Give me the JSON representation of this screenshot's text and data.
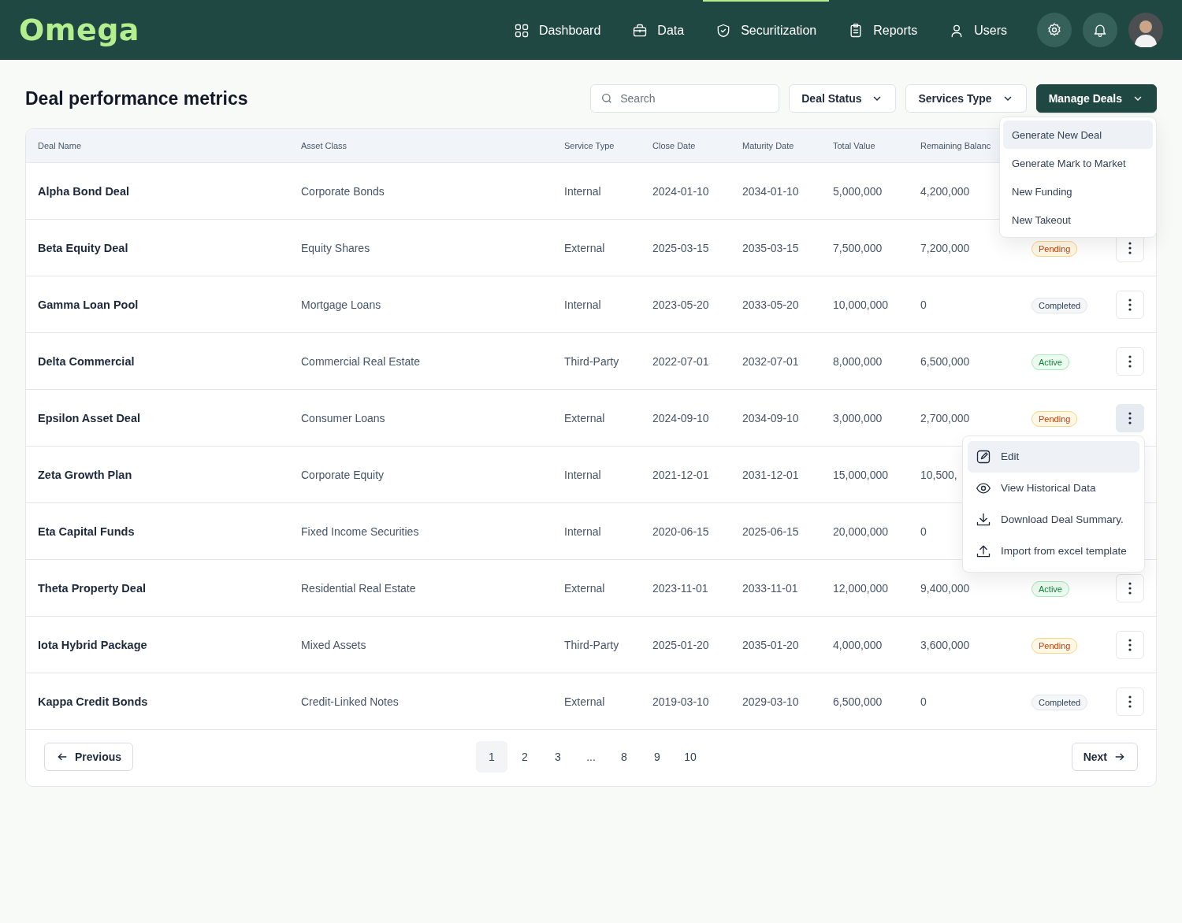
{
  "app": {
    "logo": "Omega"
  },
  "nav": [
    {
      "label": "Dashboard",
      "kind": "grid",
      "selected": false
    },
    {
      "label": "Data",
      "kind": "briefcase",
      "selected": false
    },
    {
      "label": "Securitization",
      "kind": "shield",
      "selected": true
    },
    {
      "label": "Reports",
      "kind": "clipboard",
      "selected": false
    },
    {
      "label": "Users",
      "kind": "user",
      "selected": false
    }
  ],
  "page": {
    "title": "Deal performance metrics"
  },
  "search": {
    "placeholder": "Search"
  },
  "filters": [
    {
      "label": "Deal Status",
      "kind": "outline"
    },
    {
      "label": "Services Type",
      "kind": "outline"
    },
    {
      "label": "Manage Deals",
      "kind": "primary",
      "expanded": true
    }
  ],
  "manage_menu": [
    {
      "label": "Generate New Deal",
      "selected": true
    },
    {
      "label": "Generate Mark to Market",
      "selected": false
    },
    {
      "label": "New Funding",
      "selected": false
    },
    {
      "label": "New Takeout",
      "selected": false
    }
  ],
  "table": {
    "columns": [
      "Deal Name",
      "Asset Class",
      "Service Type",
      "Close Date",
      "Maturity Date",
      "Total Value",
      "Remaining Balanc"
    ],
    "rows": [
      {
        "cells": [
          "Alpha Bond Deal",
          "Corporate Bonds",
          "Internal",
          "2024-01-10",
          "2034-01-10",
          "5,000,000",
          "4,200,000"
        ]
      },
      {
        "cells": [
          "Beta Equity Deal",
          "Equity Shares",
          "External",
          "2025-03-15",
          "2035-03-15",
          "7,500,000",
          "7,200,000"
        ],
        "status": {
          "label": "Pending",
          "kind": "pending"
        },
        "action": {
          "selected": false
        }
      },
      {
        "cells": [
          "Gamma Loan Pool",
          "Mortgage Loans",
          "Internal",
          "2023-05-20",
          "2033-05-20",
          "10,000,000",
          "0"
        ],
        "status": {
          "label": "Completed",
          "kind": "completed"
        },
        "action": {
          "selected": false
        }
      },
      {
        "cells": [
          "Delta Commercial",
          "Commercial Real Estate",
          "Third-Party",
          "2022-07-01",
          "2032-07-01",
          "8,000,000",
          "6,500,000"
        ],
        "status": {
          "label": "Active",
          "kind": "active"
        },
        "action": {
          "selected": false
        }
      },
      {
        "cells": [
          "Epsilon Asset Deal",
          "Consumer Loans",
          "External",
          "2024-09-10",
          "2034-09-10",
          "3,000,000",
          "2,700,000"
        ],
        "status": {
          "label": "Pending",
          "kind": "pending"
        },
        "action": {
          "selected": true
        },
        "menu": [
          {
            "label": "Edit",
            "kind": "edit",
            "selected": true
          },
          {
            "label": "View Historical Data",
            "kind": "view",
            "selected": false
          },
          {
            "label": "Download Deal Summary.",
            "kind": "download",
            "selected": false
          },
          {
            "label": "Import from excel template",
            "kind": "upload",
            "selected": false
          }
        ]
      },
      {
        "cells": [
          "Zeta Growth Plan",
          "Corporate Equity",
          "Internal",
          "2021-12-01",
          "2031-12-01",
          "15,000,000",
          "10,500,"
        ]
      },
      {
        "cells": [
          "Eta Capital Funds",
          "Fixed Income Securities",
          "Internal",
          "2020-06-15",
          "2025-06-15",
          "20,000,000",
          "0"
        ]
      },
      {
        "cells": [
          "Theta Property Deal",
          "Residential Real Estate",
          "External",
          "2023-11-01",
          "2033-11-01",
          "12,000,000",
          "9,400,000"
        ],
        "status": {
          "label": "Active",
          "kind": "active"
        },
        "action": {
          "selected": false
        }
      },
      {
        "cells": [
          "Iota Hybrid Package",
          "Mixed Assets",
          "Third-Party",
          "2025-01-20",
          "2035-01-20",
          "4,000,000",
          "3,600,000"
        ],
        "status": {
          "label": "Pending",
          "kind": "pending"
        },
        "action": {
          "selected": false
        }
      },
      {
        "cells": [
          "Kappa Credit Bonds",
          "Credit-Linked Notes",
          "External",
          "2019-03-10",
          "2029-03-10",
          "6,500,000",
          "0"
        ],
        "status": {
          "label": "Completed",
          "kind": "completed"
        },
        "action": {
          "selected": false
        }
      }
    ]
  },
  "pagination": {
    "previous": "Previous",
    "next": "Next",
    "pages": [
      {
        "label": "1",
        "selected": true
      },
      {
        "label": "2",
        "selected": false
      },
      {
        "label": "3",
        "selected": false
      },
      {
        "label": "...",
        "selected": false
      },
      {
        "label": "8",
        "selected": false
      },
      {
        "label": "9",
        "selected": false
      },
      {
        "label": "10",
        "selected": false
      }
    ]
  }
}
